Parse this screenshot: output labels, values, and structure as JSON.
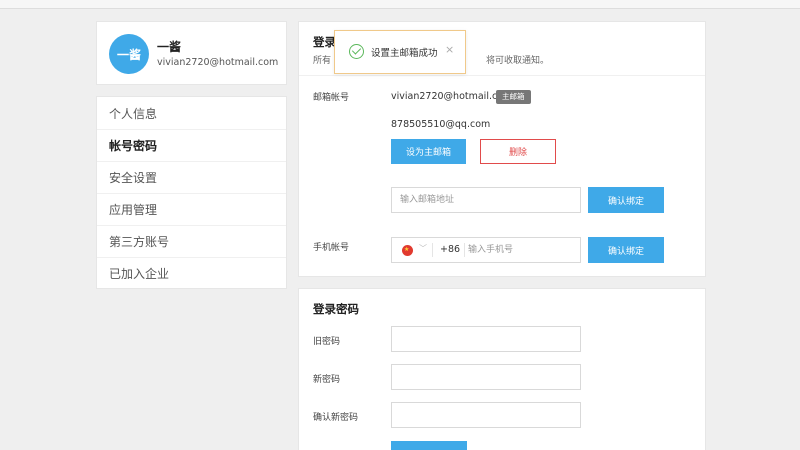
{
  "profile": {
    "avatar_text": "一酱",
    "name": "一酱",
    "email": "vivian2720@hotmail.com"
  },
  "menu": {
    "items": [
      {
        "label": "个人信息"
      },
      {
        "label": "帐号密码"
      },
      {
        "label": "安全设置"
      },
      {
        "label": "应用管理"
      },
      {
        "label": "第三方账号"
      },
      {
        "label": "已加入企业"
      }
    ]
  },
  "login_account": {
    "title": "登录",
    "desc_left": "所有",
    "desc_right": "将可收取通知。",
    "email_label": "邮箱帐号",
    "primary_email": "vivian2720@hotmail.com",
    "primary_badge": "主邮箱",
    "secondary_email": "878505510@qq.com",
    "set_primary_button": "设为主邮箱",
    "delete_button": "删除",
    "email_input_placeholder": "输入邮箱地址",
    "email_confirm_button": "确认绑定",
    "phone_label": "手机帐号",
    "country_code": "+86",
    "phone_input_placeholder": "输入手机号",
    "phone_confirm_button": "确认绑定"
  },
  "password": {
    "title": "登录密码",
    "old_label": "旧密码",
    "new_label": "新密码",
    "confirm_label": "确认新密码"
  },
  "toast": {
    "message": "设置主邮箱成功",
    "close": "×"
  },
  "colors": {
    "accent": "#3fa9e8",
    "danger": "#e14b4b",
    "badge": "#777777",
    "success": "#5cb85c"
  }
}
